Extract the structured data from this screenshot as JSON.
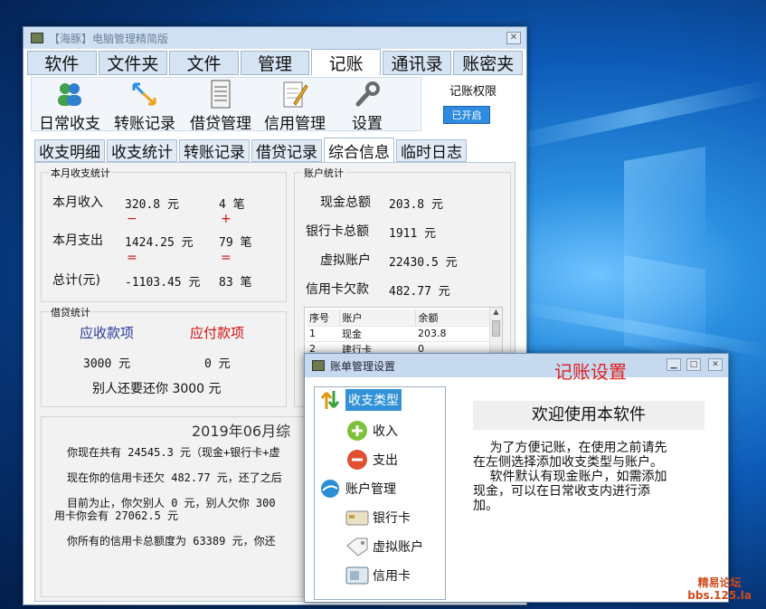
{
  "window": {
    "title": "【海豚】电脑管理精简版"
  },
  "main_tabs": [
    {
      "label": "软件",
      "selected": false
    },
    {
      "label": "文件夹",
      "selected": false
    },
    {
      "label": "文件",
      "selected": false
    },
    {
      "label": "管理",
      "selected": false
    },
    {
      "label": "记账",
      "selected": true
    },
    {
      "label": "通讯录",
      "selected": false
    },
    {
      "label": "账密夹",
      "selected": false
    }
  ],
  "toolbar": {
    "items": [
      {
        "label": "日常收支",
        "icon": "users-icon"
      },
      {
        "label": "转账记录",
        "icon": "transfer-arrows-icon"
      },
      {
        "label": "借贷管理",
        "icon": "ledger-icon"
      },
      {
        "label": "信用管理",
        "icon": "notepad-pencil-icon"
      },
      {
        "label": "设置",
        "icon": "wrench-icon"
      }
    ],
    "permission_label": "记账权限",
    "permission_button": "已开启"
  },
  "sub_tabs": [
    {
      "label": "收支明细",
      "selected": false
    },
    {
      "label": "收支统计",
      "selected": false
    },
    {
      "label": "转账记录",
      "selected": false
    },
    {
      "label": "借贷记录",
      "selected": false
    },
    {
      "label": "综合信息",
      "selected": true
    },
    {
      "label": "临时日志",
      "selected": false
    }
  ],
  "monthly": {
    "group_title": "本月收支统计",
    "income_label": "本月收入",
    "income_value": "320.8 元",
    "income_count": "4 笔",
    "plus_sign": "+",
    "minus_sign": "−",
    "expense_label": "本月支出",
    "expense_value": "1424.25 元",
    "expense_count": "79 笔",
    "equals_sign": "=",
    "total_label": "总计(元)",
    "total_value": "-1103.45 元",
    "total_count": "83 笔"
  },
  "accounts": {
    "group_title": "账户统计",
    "cash_label": "现金总额",
    "cash_value": "203.8 元",
    "bank_label": "银行卡总额",
    "bank_value": "1911 元",
    "virtual_label": "虚拟账户",
    "virtual_value": "22430.5 元",
    "credit_label": "信用卡欠款",
    "credit_value": "482.77 元",
    "table_headers": [
      "序号",
      "账户",
      "余额"
    ],
    "table_rows": [
      {
        "no": "1",
        "account": "现金",
        "balance": "203.8"
      },
      {
        "no": "2",
        "account": "建行卡",
        "balance": "0"
      }
    ]
  },
  "loans": {
    "group_title": "借贷统计",
    "receivable_label": "应收款项",
    "payable_label": "应付款项",
    "receivable_value": "3000 元",
    "payable_value": "0 元",
    "owed_text": "别人还要还你 3000 元"
  },
  "summary": {
    "heading": "2019年06月综",
    "line1": "你现在共有 24545.3 元（现金+银行卡+虚",
    "line2": "现在你的信用卡还欠 482.77 元，还了之后",
    "line3": "目前为止，你欠别人 0 元，别人欠你 300",
    "line4": "用卡你会有 27062.5 元",
    "line5": "你所有的信用卡总额度为 63389 元，你还"
  },
  "dialog": {
    "title": "账单管理设置",
    "overlay_title": "记账设置",
    "tree": [
      {
        "label": "收支类型",
        "icon": "updown-arrows-icon",
        "level": 0,
        "selected": true
      },
      {
        "label": "收入",
        "icon": "plus-circle-icon",
        "level": 1,
        "selected": false
      },
      {
        "label": "支出",
        "icon": "minus-circle-icon",
        "level": 1,
        "selected": false
      },
      {
        "label": "账户管理",
        "icon": "globe-icon",
        "level": 0,
        "selected": false
      },
      {
        "label": "银行卡",
        "icon": "bank-card-icon",
        "level": 1,
        "selected": false
      },
      {
        "label": "虚拟账户",
        "icon": "tag-icon",
        "level": 1,
        "selected": false
      },
      {
        "label": "信用卡",
        "icon": "credit-card-icon",
        "level": 1,
        "selected": false
      }
    ],
    "welcome": "欢迎使用本软件",
    "intro_lines": [
      "　 为了方便记账，在使用之前请先",
      "在左侧选择添加收支类型与账户。",
      "　 软件默认有现金账户，如需添加",
      "现金，可以在日常收支内进行添",
      "加。"
    ]
  },
  "watermark": {
    "line1": "精易论坛",
    "line2": "bbs.125.la"
  },
  "colors": {
    "accent": "#3292d8",
    "red": "#d01010",
    "blue_label": "#2a3a9a",
    "overlay_red": "#e02020"
  }
}
